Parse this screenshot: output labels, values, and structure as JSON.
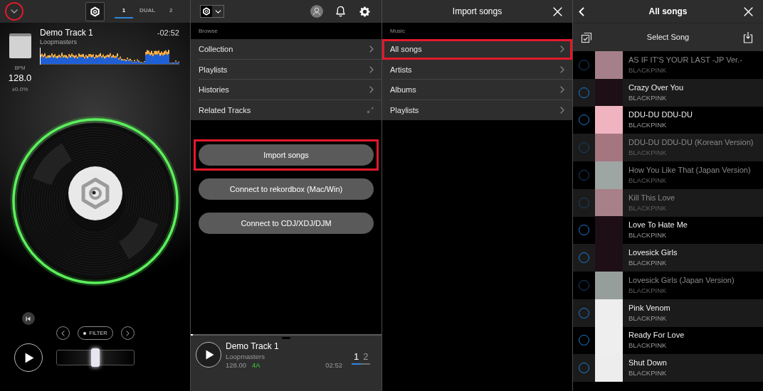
{
  "deck": {
    "menu_button": {
      "highlighted": true
    },
    "tabs": [
      {
        "label": "1",
        "selected": true
      },
      {
        "label": "DUAL",
        "selected": false
      },
      {
        "label": "2",
        "selected": false
      }
    ],
    "track": {
      "title": "Demo Track 1",
      "artist": "Loopmasters",
      "time": "-02:52"
    },
    "bpm": {
      "label": "BPM",
      "value": "128.0",
      "pitch": "±0.0%"
    },
    "filter": {
      "label": "FILTER"
    },
    "fader": {
      "level": 0.5
    }
  },
  "browser": {
    "section": "Browse",
    "items": [
      {
        "label": "Collection",
        "kind": "folder"
      },
      {
        "label": "Playlists",
        "kind": "folder"
      },
      {
        "label": "Histories",
        "kind": "folder"
      },
      {
        "label": "Related Tracks",
        "kind": "related"
      }
    ],
    "buttons": [
      {
        "label": "Import songs",
        "highlighted": true
      },
      {
        "label": "Connect to rekordbox (Mac/Win)",
        "highlighted": false
      },
      {
        "label": "Connect to CDJ/XDJ/DJM",
        "highlighted": false
      }
    ],
    "mini_player": {
      "progress": {
        "level": 0.01
      },
      "title": "Demo Track 1",
      "artist": "Loopmasters",
      "bpm": "128.00",
      "key": "4A",
      "time": "02:52",
      "decks": [
        {
          "label": "1",
          "selected": true
        },
        {
          "label": "2",
          "selected": false
        }
      ]
    }
  },
  "import": {
    "title": "Import songs",
    "section": "Music",
    "items": [
      {
        "label": "All songs",
        "highlighted": true
      },
      {
        "label": "Artists",
        "highlighted": false
      },
      {
        "label": "Albums",
        "highlighted": false
      },
      {
        "label": "Playlists",
        "highlighted": false
      }
    ]
  },
  "song_list": {
    "title": "All songs",
    "toolbar_title": "Select Song",
    "songs": [
      {
        "title": "AS IF IT'S YOUR LAST -JP Ver.-",
        "artist": "BLACKPINK",
        "disabled": true,
        "selected": false,
        "color": "#a5808a"
      },
      {
        "title": "Crazy Over You",
        "artist": "BLACKPINK",
        "disabled": false,
        "selected": false,
        "color": "#1e0f16"
      },
      {
        "title": "DDU-DU DDU-DU",
        "artist": "BLACKPINK",
        "disabled": false,
        "selected": false,
        "color": "#f0b3c0"
      },
      {
        "title": "DDU-DU DDU-DU (Korean Version)",
        "artist": "BLACKPINK",
        "disabled": true,
        "selected": false,
        "color": "#a57680"
      },
      {
        "title": "How You Like That (Japan Version)",
        "artist": "BLACKPINK",
        "disabled": true,
        "selected": false,
        "color": "#9ea6a4"
      },
      {
        "title": "Kill This Love",
        "artist": "BLACKPINK",
        "disabled": true,
        "selected": false,
        "color": "#a88089"
      },
      {
        "title": "Love To Hate Me",
        "artist": "BLACKPINK",
        "disabled": false,
        "selected": false,
        "color": "#1e0f16"
      },
      {
        "title": "Lovesick Girls",
        "artist": "BLACKPINK",
        "disabled": false,
        "selected": false,
        "color": "#1e0f16"
      },
      {
        "title": "Lovesick Girls (Japan Version)",
        "artist": "BLACKPINK",
        "disabled": true,
        "selected": false,
        "color": "#969e9c"
      },
      {
        "title": "Pink Venom",
        "artist": "BLACKPINK",
        "disabled": false,
        "selected": false,
        "color": "#eeeeee"
      },
      {
        "title": "Ready For Love",
        "artist": "BLACKPINK",
        "disabled": false,
        "selected": false,
        "color": "#eeeeee"
      },
      {
        "title": "Shut Down",
        "artist": "BLACKPINK",
        "disabled": false,
        "selected": false,
        "color": "#ededed"
      }
    ]
  }
}
